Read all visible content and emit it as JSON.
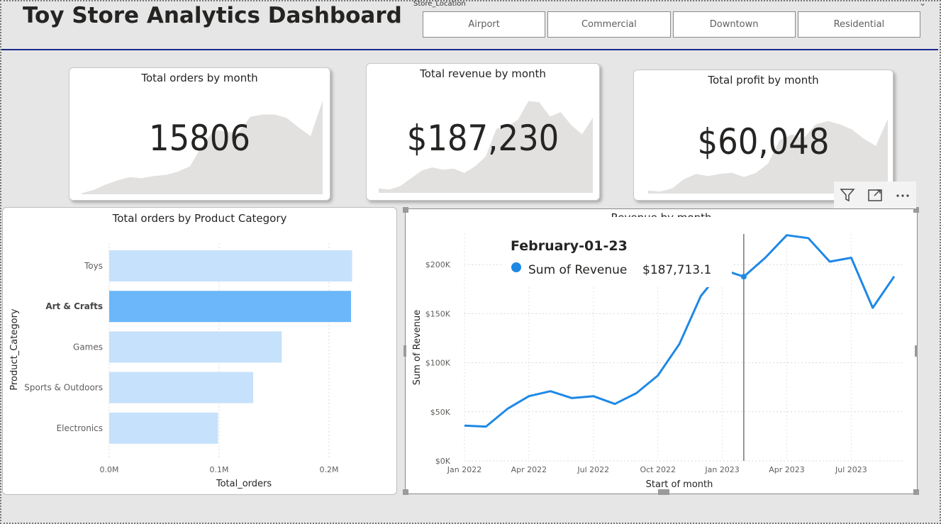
{
  "header": {
    "title": "Toy Store Analytics Dashboard"
  },
  "slicer": {
    "label": "Store_Location",
    "options": [
      "Airport",
      "Commercial",
      "Downtown",
      "Residential"
    ]
  },
  "kpis": [
    {
      "title": "Total orders by month",
      "value": "15806",
      "spark": [
        1,
        4,
        9,
        13,
        16,
        15,
        17,
        18,
        21,
        26,
        45,
        60,
        58,
        57,
        72,
        74,
        74,
        71,
        62,
        54,
        87
      ]
    },
    {
      "title": "Total revenue by month",
      "value": "$187,230",
      "spark": [
        4,
        3,
        6,
        13,
        20,
        23,
        21,
        22,
        18,
        24,
        33,
        58,
        60,
        66,
        83,
        82,
        69,
        73,
        61,
        53,
        68
      ]
    },
    {
      "title": "Total profit by month",
      "value": "$60,048",
      "spark": [
        3,
        2,
        5,
        14,
        19,
        17,
        19,
        20,
        16,
        20,
        29,
        52,
        57,
        54,
        67,
        70,
        67,
        62,
        53,
        46,
        72
      ]
    }
  ],
  "icons": {
    "filter": "filter-icon",
    "focus": "focus-mode-icon",
    "more": "more-options-icon"
  },
  "colors": {
    "bar_default": "#c6e1fb",
    "bar_highlight": "#6cb7fa",
    "line": "#1e88e5",
    "title_rule": "#1a2a8a",
    "spark_fill": "#e2e1df"
  },
  "chart_data": [
    {
      "type": "bar",
      "orientation": "horizontal",
      "title": "Total orders by Product Category",
      "xlabel": "Total_orders",
      "ylabel": "Product_Category",
      "categories": [
        "Toys",
        "Art & Crafts",
        "Games",
        "Sports & Outdoors",
        "Electronics"
      ],
      "values": [
        0.221,
        0.22,
        0.157,
        0.131,
        0.099
      ],
      "highlighted": "Art & Crafts",
      "xticks": [
        "0.0M",
        "0.1M",
        "0.2M"
      ],
      "xlim": [
        0,
        0.25
      ],
      "grid": true
    },
    {
      "type": "line",
      "title": "Revenue by month",
      "xlabel": "Start of month",
      "ylabel": "Sum of Revenue",
      "x": [
        "2022-01",
        "2022-02",
        "2022-03",
        "2022-04",
        "2022-05",
        "2022-06",
        "2022-07",
        "2022-08",
        "2022-09",
        "2022-10",
        "2022-11",
        "2022-12",
        "2023-01",
        "2023-02",
        "2023-03",
        "2023-04",
        "2023-05",
        "2023-06",
        "2023-07",
        "2023-08",
        "2023-09"
      ],
      "series": [
        {
          "name": "Sum of Revenue",
          "values": [
            36000,
            35000,
            53000,
            66000,
            71000,
            64000,
            66000,
            58000,
            69000,
            87000,
            119000,
            168000,
            195000,
            187713.1,
            207000,
            230000,
            227000,
            203000,
            207000,
            156000,
            188000
          ]
        }
      ],
      "xticks": [
        "Jan 2022",
        "Apr 2022",
        "Jul 2022",
        "Oct 2022",
        "Jan 2023",
        "Apr 2023",
        "Jul 2023"
      ],
      "yticks": [
        "$0K",
        "$50K",
        "$100K",
        "$150K",
        "$200K"
      ],
      "ylim": [
        0,
        200000
      ],
      "grid": true,
      "tooltip": {
        "date": "February-01-23",
        "series": "Sum of Revenue",
        "value": "$187,713.1",
        "index": 13
      }
    }
  ]
}
